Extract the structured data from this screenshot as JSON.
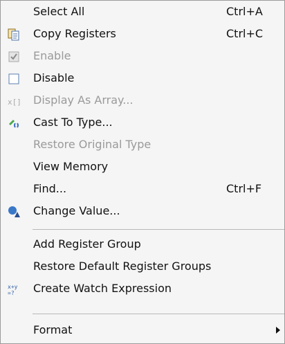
{
  "menu": {
    "select_all": {
      "label": "Select All",
      "shortcut": "Ctrl+A"
    },
    "copy_registers": {
      "label": "Copy Registers",
      "shortcut": "Ctrl+C",
      "icon": "copy-icon"
    },
    "enable": {
      "label": "Enable",
      "checked": true,
      "enabled": false,
      "icon": "checkbox-checked-icon"
    },
    "disable": {
      "label": "Disable",
      "icon": "checkbox-empty-icon"
    },
    "display_as_array": {
      "label": "Display As Array...",
      "enabled": false,
      "icon": "array-icon"
    },
    "cast_to_type": {
      "label": "Cast To Type...",
      "icon": "cast-type-icon"
    },
    "restore_original_type": {
      "label": "Restore Original Type",
      "enabled": false
    },
    "view_memory": {
      "label": "View Memory"
    },
    "find": {
      "label": "Find...",
      "shortcut": "Ctrl+F"
    },
    "change_value": {
      "label": "Change Value...",
      "icon": "change-value-icon"
    },
    "add_register_group": {
      "label": "Add Register Group"
    },
    "restore_default_groups": {
      "label": "Restore Default Register Groups"
    },
    "create_watch_expression": {
      "label": "Create Watch Expression",
      "icon": "watch-expression-icon"
    },
    "format": {
      "label": "Format",
      "has_submenu": true
    }
  },
  "colors": {
    "background": "#f5f5f5",
    "text": "#111111",
    "disabled_text": "#9a9a9a",
    "separator": "#b8b8b8"
  }
}
